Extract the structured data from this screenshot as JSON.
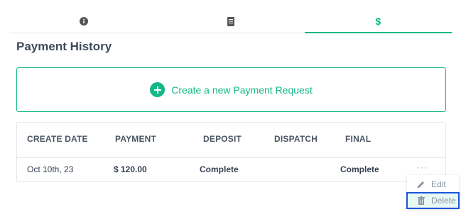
{
  "tabs": [
    {
      "icon": "info-circle-icon",
      "active": false
    },
    {
      "icon": "receipt-icon",
      "active": false
    },
    {
      "icon": "dollar-icon",
      "symbol": "$",
      "active": true
    }
  ],
  "page": {
    "title": "Payment History"
  },
  "create_request": {
    "label": "Create a new Payment Request"
  },
  "table": {
    "headers": [
      "CREATE DATE",
      "PAYMENT",
      "DEPOSIT",
      "DISPATCH",
      "FINAL"
    ],
    "rows": [
      {
        "create_date": "Oct 10th, 23",
        "payment": "$ 120.00",
        "deposit": "Complete",
        "dispatch": "",
        "final": "Complete",
        "more": "···"
      }
    ]
  },
  "row_menu": {
    "items": [
      {
        "label": "Edit",
        "icon": "pencil-icon"
      },
      {
        "label": "Delete",
        "icon": "trash-icon"
      }
    ]
  },
  "colors": {
    "accent": "#12b886",
    "focus": "#1a56db"
  }
}
